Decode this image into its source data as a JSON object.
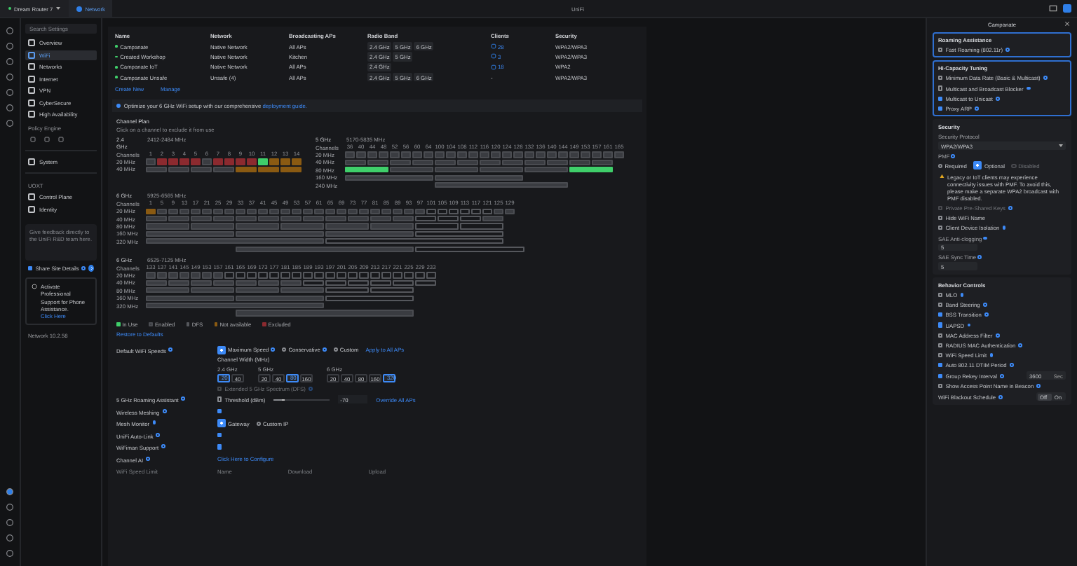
{
  "topbar": {
    "device": "Dream Router 7",
    "app": "Network",
    "title": "UniFi"
  },
  "search": {
    "placeholder": "Search Settings"
  },
  "nav": [
    {
      "label": "Overview",
      "selected": false
    },
    {
      "label": "WiFi",
      "selected": true
    },
    {
      "label": "Networks",
      "selected": false
    },
    {
      "label": "Internet",
      "selected": false
    },
    {
      "label": "VPN",
      "selected": false
    },
    {
      "label": "CyberSecure",
      "selected": false
    },
    {
      "label": "High Availability",
      "selected": false
    }
  ],
  "policy_engine": {
    "title": "Policy Engine"
  },
  "system": {
    "label": "System",
    "selected": false
  },
  "uiot": {
    "title": "UOXT",
    "items": [
      {
        "label": "Control Plane",
        "selected": false
      },
      {
        "label": "Identity",
        "selected": false
      }
    ]
  },
  "feedback": {
    "placeholder": "Give feedback directly to the UniFi R&D team here.",
    "share_label": "Share Site Details",
    "share_checked": true
  },
  "support": {
    "text": "Activate Professional Support for Phone Assistance.",
    "link": "Click Here"
  },
  "version": "Network 10.2.58",
  "table": {
    "columns": [
      "Name",
      "Network",
      "Broadcasting APs",
      "Radio Band",
      "Clients",
      "Security"
    ],
    "rows": [
      {
        "name": "Campanate",
        "enabled": true,
        "network": "Native Network",
        "aps": "All APs",
        "bands": [
          "2.4 GHz",
          "5 GHz",
          "6 GHz"
        ],
        "clients": "28",
        "clients_link": true,
        "security": "WPA2/WPA3"
      },
      {
        "name": "Created Workshop",
        "enabled": true,
        "network": "Native Network",
        "aps": "Kitchen",
        "bands": [
          "2.4 GHz",
          "5 GHz"
        ],
        "clients": "3",
        "clients_link": true,
        "security": "WPA2/WPA3"
      },
      {
        "name": "Campanate IoT",
        "enabled": true,
        "network": "Native Network",
        "aps": "All APs",
        "bands": [
          "2.4 GHz"
        ],
        "clients": "18",
        "clients_link": true,
        "security": "WPA2"
      },
      {
        "name": "Campanate Unsafe",
        "enabled": true,
        "network": "Unsafe (4)",
        "aps": "All APs",
        "bands": [
          "2.4 GHz",
          "5 GHz",
          "6 GHz"
        ],
        "clients": "-",
        "clients_link": false,
        "security": "WPA2/WPA3"
      }
    ],
    "actions": [
      "Create New",
      "Manage"
    ]
  },
  "banner": {
    "text": "Optimize your 6 GHz WiFi setup with our comprehensive",
    "link": "deployment guide."
  },
  "channel_plan": {
    "title": "Channel Plan",
    "subtitle": "Click on a channel to exclude it from use",
    "bands": [
      {
        "band": "2.4 GHz",
        "range": "2412-2484 MHz",
        "channels_label": "Channels",
        "channels": [
          "1",
          "2",
          "3",
          "4",
          "5",
          "6",
          "7",
          "8",
          "9",
          "10",
          "11",
          "12",
          "13",
          "14"
        ],
        "rows": [
          {
            "label": "20 MHz",
            "kind": "w20",
            "cells": [
              {
                "kind": "on"
              },
              {
                "kind": "excl"
              },
              {
                "kind": "excl"
              },
              {
                "kind": "excl"
              },
              {
                "kind": "excl"
              },
              {
                "kind": "on"
              },
              {
                "kind": "excl"
              },
              {
                "kind": "excl"
              },
              {
                "kind": "excl"
              },
              {
                "kind": "excl"
              },
              {
                "kind": "use"
              },
              {
                "kind": "na"
              },
              {
                "kind": "na"
              },
              {
                "kind": "na"
              }
            ]
          },
          {
            "label": "40 MHz",
            "kind": "w40",
            "cells": [
              {
                "kind": "on"
              },
              {
                "kind": "on"
              },
              {
                "kind": "on"
              },
              {
                "kind": "on"
              },
              {
                "kind": "na"
              },
              {
                "kind": "na"
              },
              {
                "kind": "na"
              }
            ]
          }
        ]
      },
      {
        "band": "5 GHz",
        "range": "5170-5835 MHz",
        "channels_label": "Channels",
        "channels": [
          "36",
          "40",
          "44",
          "48",
          "52",
          "56",
          "60",
          "64",
          "100",
          "104",
          "108",
          "112",
          "116",
          "120",
          "124",
          "128",
          "132",
          "136",
          "140",
          "144",
          "149",
          "153",
          "157",
          "161",
          "165"
        ],
        "rows": [
          {
            "label": "20 MHz",
            "kind": "w20",
            "cells": [
              {
                "kind": "on"
              },
              {
                "kind": "on"
              },
              {
                "kind": "on"
              },
              {
                "kind": "on"
              },
              {
                "kind": "on"
              },
              {
                "kind": "on"
              },
              {
                "kind": "on"
              },
              {
                "kind": "on"
              },
              {
                "kind": "on"
              },
              {
                "kind": "on"
              },
              {
                "kind": "on"
              },
              {
                "kind": "on"
              },
              {
                "kind": "on"
              },
              {
                "kind": "on"
              },
              {
                "kind": "on"
              },
              {
                "kind": "on"
              },
              {
                "kind": "on"
              },
              {
                "kind": "on"
              },
              {
                "kind": "on"
              },
              {
                "kind": "on"
              },
              {
                "kind": "on"
              },
              {
                "kind": "on"
              },
              {
                "kind": "on"
              },
              {
                "kind": "on"
              },
              {
                "kind": "on"
              }
            ]
          },
          {
            "label": "40 MHz",
            "kind": "w40",
            "cells": [
              {
                "kind": "on"
              },
              {
                "kind": "on"
              },
              {
                "kind": "on"
              },
              {
                "kind": "on"
              },
              {
                "kind": "on"
              },
              {
                "kind": "on"
              },
              {
                "kind": "on"
              },
              {
                "kind": "on"
              },
              {
                "kind": "on"
              },
              {
                "kind": "on"
              },
              {
                "kind": "on"
              },
              {
                "kind": "on"
              }
            ]
          },
          {
            "label": "80 MHz",
            "kind": "w80",
            "cells": [
              {
                "kind": "use"
              },
              {
                "kind": "on"
              },
              {
                "kind": "on"
              },
              {
                "kind": "on"
              },
              {
                "kind": "on"
              },
              {
                "kind": "use"
              }
            ]
          },
          {
            "label": "160 MHz",
            "kind": "w160",
            "cells": [
              {
                "kind": "on"
              },
              {
                "kind": "on"
              }
            ]
          },
          {
            "label": "240 MHz",
            "kind": "w240",
            "cells": [
              {
                "kind": "on"
              }
            ]
          }
        ]
      },
      {
        "band": "6 GHz",
        "range": "5925-6565 MHz",
        "channels_label": "Channels",
        "channels": [
          "1",
          "5",
          "9",
          "13",
          "17",
          "21",
          "25",
          "29",
          "33",
          "37",
          "41",
          "45",
          "49",
          "53",
          "57",
          "61",
          "65",
          "69",
          "73",
          "77",
          "81",
          "85",
          "89",
          "93",
          "97",
          "101",
          "105",
          "109",
          "113",
          "117",
          "121",
          "125",
          "129"
        ],
        "rows": [
          {
            "label": "20 MHz",
            "kind": "w20",
            "cells": [
              {
                "kind": "na"
              },
              {
                "kind": "on"
              },
              {
                "kind": "on"
              },
              {
                "kind": "on"
              },
              {
                "kind": "on"
              },
              {
                "kind": "on"
              },
              {
                "kind": "on"
              },
              {
                "kind": "on"
              },
              {
                "kind": "on"
              },
              {
                "kind": "on"
              },
              {
                "kind": "on"
              },
              {
                "kind": "on"
              },
              {
                "kind": "on"
              },
              {
                "kind": "on"
              },
              {
                "kind": "on"
              },
              {
                "kind": "on"
              },
              {
                "kind": "on"
              },
              {
                "kind": "on"
              },
              {
                "kind": "on"
              },
              {
                "kind": "on"
              },
              {
                "kind": "on"
              },
              {
                "kind": "on"
              },
              {
                "kind": "on"
              },
              {
                "kind": "on"
              },
              {
                "kind": "on"
              },
              {
                "kind": "dfs"
              },
              {
                "kind": "dfs"
              },
              {
                "kind": "dfs"
              },
              {
                "kind": "dfs"
              },
              {
                "kind": "dfs"
              },
              {
                "kind": "dfs"
              },
              {
                "kind": "on"
              },
              {
                "kind": "on"
              }
            ]
          },
          {
            "label": "40 MHz",
            "kind": "w40",
            "cells": [
              {
                "kind": "on"
              },
              {
                "kind": "on"
              },
              {
                "kind": "on"
              },
              {
                "kind": "on"
              },
              {
                "kind": "on"
              },
              {
                "kind": "on"
              },
              {
                "kind": "on"
              },
              {
                "kind": "on"
              },
              {
                "kind": "on"
              },
              {
                "kind": "on"
              },
              {
                "kind": "on"
              },
              {
                "kind": "on"
              },
              {
                "kind": "dfs"
              },
              {
                "kind": "dfs"
              },
              {
                "kind": "dfs"
              },
              {
                "kind": "on"
              }
            ]
          },
          {
            "label": "80 MHz",
            "kind": "w80",
            "cells": [
              {
                "kind": "on"
              },
              {
                "kind": "on"
              },
              {
                "kind": "on"
              },
              {
                "kind": "on"
              },
              {
                "kind": "on"
              },
              {
                "kind": "on"
              },
              {
                "kind": "dfs"
              },
              {
                "kind": "dfs"
              }
            ]
          },
          {
            "label": "160 MHz",
            "kind": "w160",
            "cells": [
              {
                "kind": "on"
              },
              {
                "kind": "on"
              },
              {
                "kind": "on"
              },
              {
                "kind": "dfs"
              }
            ]
          },
          {
            "label": "320 MHz",
            "kind": "w320",
            "cells": [
              {
                "kind": "on"
              },
              {
                "kind": "dfs"
              }
            ]
          },
          {
            "kind": "w320b",
            "cells": [
              {
                "kind": "on"
              },
              {
                "kind": "dfs"
              }
            ]
          }
        ]
      },
      {
        "band": "6 GHz",
        "range": "6525-7125 MHz",
        "channels_label": "Channels",
        "channels": [
          "133",
          "137",
          "141",
          "145",
          "149",
          "153",
          "157",
          "161",
          "165",
          "169",
          "173",
          "177",
          "181",
          "185",
          "189",
          "193",
          "197",
          "201",
          "205",
          "209",
          "213",
          "217",
          "221",
          "225",
          "229",
          "233"
        ],
        "rows": [
          {
            "label": "20 MHz",
            "kind": "w20",
            "cells": [
              {
                "kind": "on"
              },
              {
                "kind": "on"
              },
              {
                "kind": "on"
              },
              {
                "kind": "on"
              },
              {
                "kind": "on"
              },
              {
                "kind": "on"
              },
              {
                "kind": "on"
              },
              {
                "kind": "dfs"
              },
              {
                "kind": "dfs"
              },
              {
                "kind": "dfs"
              },
              {
                "kind": "dfs"
              },
              {
                "kind": "dfs"
              },
              {
                "kind": "dfs"
              },
              {
                "kind": "dfs"
              },
              {
                "kind": "dfs"
              },
              {
                "kind": "dfs"
              },
              {
                "kind": "dfs"
              },
              {
                "kind": "dfs"
              },
              {
                "kind": "dfs"
              },
              {
                "kind": "dfs"
              },
              {
                "kind": "dfs"
              },
              {
                "kind": "dfs"
              },
              {
                "kind": "dfs"
              },
              {
                "kind": "dfs"
              },
              {
                "kind": "dfs"
              },
              {
                "kind": "dfs"
              }
            ]
          },
          {
            "label": "40 MHz",
            "kind": "w40",
            "cells": [
              {
                "kind": "on"
              },
              {
                "kind": "on"
              },
              {
                "kind": "on"
              },
              {
                "kind": "on"
              },
              {
                "kind": "on"
              },
              {
                "kind": "on"
              },
              {
                "kind": "on"
              },
              {
                "kind": "dfs"
              },
              {
                "kind": "dfs"
              },
              {
                "kind": "dfs"
              },
              {
                "kind": "dfs"
              },
              {
                "kind": "dfs"
              },
              {
                "kind": "dfs"
              }
            ]
          },
          {
            "label": "80 MHz",
            "kind": "w80",
            "cells": [
              {
                "kind": "on"
              },
              {
                "kind": "on"
              },
              {
                "kind": "on"
              },
              {
                "kind": "on"
              },
              {
                "kind": "dfs"
              },
              {
                "kind": "dfs"
              }
            ]
          },
          {
            "label": "160 MHz",
            "kind": "w160",
            "cells": [
              {
                "kind": "on"
              },
              {
                "kind": "on"
              },
              {
                "kind": "dfs"
              }
            ]
          },
          {
            "label": "320 MHz",
            "kind": "w320",
            "cells": [
              {
                "kind": "on"
              }
            ]
          },
          {
            "kind": "w320b",
            "cells": [
              {
                "kind": "on"
              }
            ]
          }
        ]
      }
    ],
    "legend": [
      {
        "label": "In Use",
        "kind": "use"
      },
      {
        "label": "Enabled",
        "kind": "on"
      },
      {
        "label": "DFS",
        "kind": "dfs"
      },
      {
        "label": "Not available",
        "kind": "na"
      },
      {
        "label": "Excluded",
        "kind": "excl"
      }
    ],
    "restore": "Restore to Defaults"
  },
  "settings": [
    {
      "kind": "speeds",
      "label": "Default WiFi Speeds",
      "radios": [
        {
          "label": "Maximum Speed",
          "selected": true
        },
        {
          "label": "Conservative",
          "selected": false
        },
        {
          "label": "Custom",
          "selected": false
        }
      ],
      "link": "Apply to All APs",
      "width_title": "Channel Width (MHz)",
      "groups": [
        {
          "band": "2.4 GHz",
          "widths": [
            {
              "label": "20",
              "selected": true
            },
            {
              "label": "40",
              "selected": false
            }
          ]
        },
        {
          "band": "5 GHz",
          "widths": [
            {
              "label": "20",
              "selected": false
            },
            {
              "label": "40",
              "selected": false
            },
            {
              "label": "80",
              "selected": true
            },
            {
              "label": "160",
              "selected": false
            }
          ]
        },
        {
          "band": "6 GHz",
          "widths": [
            {
              "label": "20",
              "selected": false
            },
            {
              "label": "40",
              "selected": false
            },
            {
              "label": "80",
              "selected": false
            },
            {
              "label": "160",
              "selected": false
            },
            {
              "label": "320",
              "selected": true
            }
          ]
        }
      ],
      "extended": {
        "label": "Extended 5 GHz Spectrum (DFS)",
        "checked": false,
        "disabled": true
      }
    },
    {
      "kind": "roaming",
      "label": "5 GHz Roaming Assistant",
      "check_label": "Threshold (dBm)",
      "checked": false,
      "level": 0.2,
      "value": "-70",
      "link": "Override All APs"
    },
    {
      "kind": "check",
      "label": "Wireless Meshing",
      "checked": true
    },
    {
      "kind": "radios",
      "label": "Mesh Monitor",
      "radios": [
        {
          "label": "Gateway",
          "selected": true
        },
        {
          "label": "Custom IP",
          "selected": false
        }
      ]
    },
    {
      "kind": "check",
      "label": "UniFi Auto-Link",
      "checked": true
    },
    {
      "kind": "check",
      "label": "WiFiman Support",
      "checked": true
    },
    {
      "kind": "link",
      "label": "Channel AI",
      "link": "Click Here to Configure"
    },
    {
      "kind": "columns",
      "label": "WiFi Speed Limit",
      "columns": [
        "Name",
        "Download",
        "Upload"
      ]
    }
  ],
  "panel": {
    "title": "Campanate",
    "cards": [
      {
        "title": "Roaming Assistance",
        "highlighted": true,
        "items": [
          {
            "kind": "check",
            "label": "Fast Roaming (802.11r)",
            "checked": false,
            "disabled": false,
            "info": true
          }
        ]
      },
      {
        "title": "Hi-Capacity Tuning",
        "highlighted": true,
        "items": [
          {
            "kind": "check",
            "label": "Minimum Data Rate (Basic & Multicast)",
            "checked": false,
            "disabled": false,
            "info": true
          },
          {
            "kind": "check",
            "label": "Multicast and Broadcast Blocker",
            "checked": false,
            "disabled": false,
            "info": true
          },
          {
            "kind": "check",
            "label": "Multicast to Unicast",
            "checked": true,
            "disabled": false,
            "info": true
          },
          {
            "kind": "check",
            "label": "Proxy ARP",
            "checked": true,
            "disabled": false,
            "info": true
          }
        ]
      },
      {
        "title": "Security",
        "highlighted": false,
        "items": [
          {
            "kind": "select",
            "label": "Security Protocol",
            "value": "WPA2/WPA3"
          },
          {
            "kind": "radios",
            "label": "PMF",
            "radios": [
              {
                "label": "Required",
                "selected": false,
                "disabled": false
              },
              {
                "label": "Optional",
                "selected": true,
                "disabled": false
              },
              {
                "label": "Disabled",
                "selected": false,
                "disabled": true
              }
            ]
          },
          {
            "kind": "warning",
            "text": "Legacy or IoT clients may experience connectivity issues with PMF. To avoid this, please make a separate WPA2 broadcast with PMF disabled."
          },
          {
            "kind": "check",
            "label": "Private Pre-Shared Keys",
            "checked": false,
            "disabled": true,
            "info": true
          },
          {
            "kind": "check",
            "label": "Hide WiFi Name",
            "checked": false,
            "disabled": false,
            "info": false
          },
          {
            "kind": "check",
            "label": "Client Device Isolation",
            "checked": false,
            "disabled": false,
            "info": true
          },
          {
            "kind": "number",
            "label": "SAE Anti-clogging",
            "value": "5"
          },
          {
            "kind": "number",
            "label": "SAE Sync Time",
            "value": "5"
          }
        ]
      },
      {
        "title": "Behavior Controls",
        "highlighted": false,
        "items": [
          {
            "kind": "check",
            "label": "MLO",
            "checked": false,
            "disabled": false,
            "info": true
          },
          {
            "kind": "check",
            "label": "Band Steering",
            "checked": false,
            "disabled": false,
            "info": true
          },
          {
            "kind": "check",
            "label": "BSS Transition",
            "checked": true,
            "disabled": false,
            "info": true
          },
          {
            "kind": "check",
            "label": "UAPSD",
            "checked": true,
            "disabled": false,
            "info": true
          },
          {
            "kind": "check",
            "label": "MAC Address Filter",
            "checked": false,
            "disabled": false,
            "info": true
          },
          {
            "kind": "check",
            "label": "RADIUS MAC Authentication",
            "checked": false,
            "disabled": false,
            "info": true
          },
          {
            "kind": "check",
            "label": "WiFi Speed Limit",
            "checked": false,
            "disabled": false,
            "info": true
          },
          {
            "kind": "check",
            "label": "Auto 802.11 DTIM Period",
            "checked": true,
            "disabled": false,
            "info": true
          },
          {
            "kind": "check_value",
            "label": "Group Rekey Interval",
            "checked": true,
            "info": true,
            "value": "3600",
            "unit": "Sec"
          },
          {
            "kind": "check",
            "label": "Show Access Point Name in Beacon",
            "checked": false,
            "disabled": false,
            "info": true
          },
          {
            "kind": "toggle",
            "label": "WiFi Blackout Schedule",
            "options": [
              {
                "label": "Off",
                "selected": true
              },
              {
                "label": "On",
                "selected": false
              }
            ]
          }
        ]
      }
    ]
  }
}
